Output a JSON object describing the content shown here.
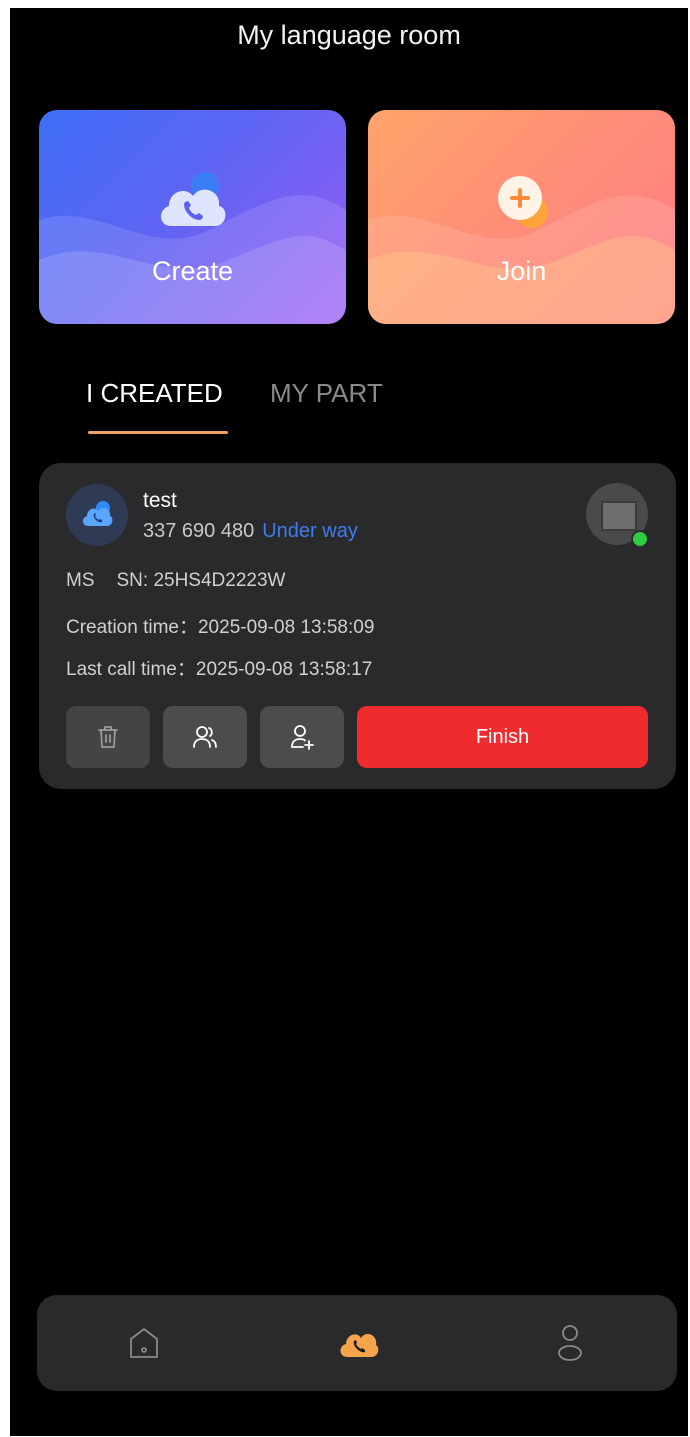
{
  "header": {
    "title": "My language room"
  },
  "actions": {
    "create_label": "Create",
    "join_label": "Join"
  },
  "tabs": [
    {
      "label": "I CREATED",
      "active": true
    },
    {
      "label": "MY PART",
      "active": false
    }
  ],
  "room": {
    "name": "test",
    "number": "337 690 480",
    "status": "Under way",
    "ms_label": "MS",
    "sn": "SN: 25HS4D2223W",
    "creation_time": "Creation time：2025-09-08 13:58:09",
    "last_call_time": "Last call time：2025-09-08 13:58:17",
    "device_online": true,
    "finish_label": "Finish"
  },
  "nav": {
    "items": [
      {
        "icon": "home-icon",
        "active": false
      },
      {
        "icon": "call-cloud-icon",
        "active": true
      },
      {
        "icon": "profile-icon",
        "active": false
      }
    ]
  },
  "colors": {
    "accent": "#f0a060",
    "status_blue": "#3d7cf0",
    "finish_red": "#ef2b2f",
    "online_green": "#2ecc40"
  }
}
